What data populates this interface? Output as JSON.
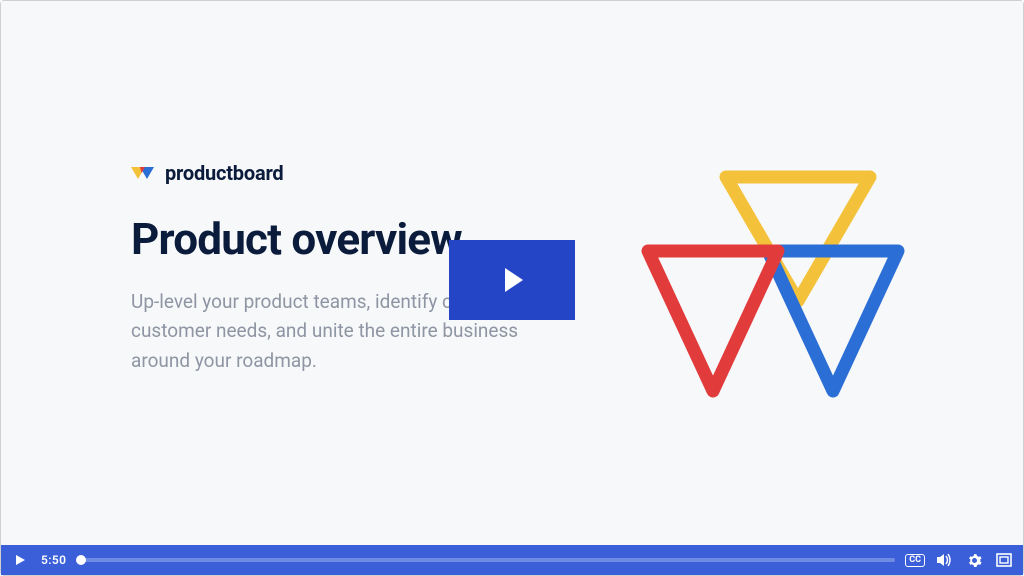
{
  "brand": {
    "name": "productboard"
  },
  "heading": "Product overview",
  "subtext": "Up-level your product teams, identify critical customer needs, and unite the entire business around your roadmap.",
  "controls": {
    "time": "5:50",
    "cc_label": "CC"
  },
  "colors": {
    "accent": "#2445c6",
    "bar": "#3a5fd9",
    "yellow": "#f3c13a",
    "red": "#e23b3b",
    "blue": "#2b6fd6"
  }
}
